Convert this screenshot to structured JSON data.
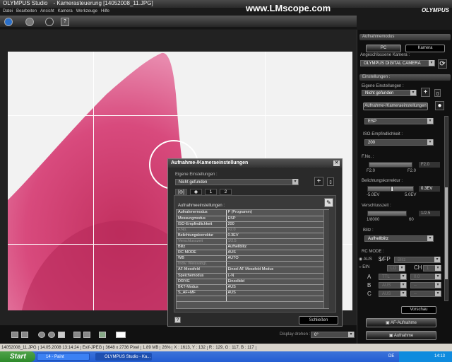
{
  "window": {
    "app": "OLYMPUS Studio",
    "title": "- Kamerasteuerung [14052008_11.JPG]",
    "watermark": "www.LMscope.com",
    "brand": "OLYMPUS"
  },
  "menu": [
    "Datei",
    "Bearbeiten",
    "Ansicht",
    "Kamera",
    "Werkzeuge",
    "Hilfe"
  ],
  "right_panel": {
    "section_mode": "Aufnahmemodus",
    "pc": "PC",
    "camera": "Kamera",
    "connected_camera_label": "Angeschlossene Kamera :",
    "connected_camera": "OLYMPUS DIGITAL CAMERA",
    "section_settings": "Einstellungen :",
    "own_settings_label": "Eigene Einstellungen :",
    "own_settings": "Nicht gefunden",
    "shoot_settings_button": "Aufnahme-/Kameraeinstellungen",
    "metering": "ESP",
    "iso_label": "ISO-Empfindlichkeit :",
    "iso": "200",
    "fno_label": "F.No. :",
    "fno_value": "F2.0",
    "fno_min": "F2.0",
    "fno_max": "F2.0",
    "exp_label": "Belichtungskorrektur :",
    "exp_value": "0.3EV",
    "exp_min": "-5.0EV",
    "exp_max": "5.0EV",
    "exp_fraction": 0.53,
    "shutter_label": "Verschlusszeit :",
    "shutter_value": "1/2.5",
    "shutter_min": "1/8000",
    "shutter_max": "60",
    "flash_label": "Blitz :",
    "flash": "Aufhellblitz",
    "rc_label": "RC MODE :",
    "rc_off": "AUS",
    "rc_on": "EIN",
    "rc_selected": "AUS",
    "fp": "$/FP",
    "fp_value": "Blitz",
    "lo": "LO",
    "ch": "CH",
    "ch_value": "1",
    "groups": [
      {
        "g": "A",
        "mode": "TTL",
        "val": "0.0"
      },
      {
        "g": "B",
        "mode": "AUS",
        "val": "--"
      },
      {
        "g": "C",
        "mode": "AUS",
        "val": "--"
      }
    ],
    "preview": "Vorschau",
    "af_shoot": "AF-Aufnahme",
    "shoot": "Aufnahme"
  },
  "dialog": {
    "title": "Aufnahme-/Kameraeinstellungen",
    "own_label": "Eigene Einstellungen :",
    "own_value": "Nicht gefunden",
    "tabs": [
      "[◎]",
      "◉",
      "1",
      "2"
    ],
    "table_label": "Aufnahmeeinstellungen :",
    "rows": [
      {
        "k": "Aufnahmemodus",
        "v": "P (Programm)"
      },
      {
        "k": "Messungmodus",
        "v": "ESP"
      },
      {
        "k": "ISO-Empfindlichkeit",
        "v": "200"
      },
      {
        "k": "F.No.",
        "v": "F2.0",
        "disabled": true
      },
      {
        "k": "Belichtungskorrektur",
        "v": "0.3EV"
      },
      {
        "k": "Verschlusszeit",
        "v": "1/2.5",
        "disabled": true
      },
      {
        "k": "Blitz",
        "v": "Aufhellblitz"
      },
      {
        "k": "RC MODE",
        "v": "AUS"
      },
      {
        "k": "WB",
        "v": "AUTO"
      },
      {
        "k": "Indiv. Weissabgl.",
        "v": "--",
        "disabled": true
      },
      {
        "k": "AF-Messfeld",
        "v": "Einzel AF Messfeld Modus"
      },
      {
        "k": "Speichemodus",
        "v": "L-N"
      },
      {
        "k": "DRIVE",
        "v": "Einzelbild"
      },
      {
        "k": "BKT-Modus",
        "v": "AUS"
      },
      {
        "k": "S_AF+MF",
        "v": "AUS"
      },
      {
        "k": "",
        "v": ""
      }
    ],
    "close": "Schließen",
    "help": "?"
  },
  "bottom": {
    "rotate_label": "Display drehen :",
    "rotate_value": "0°"
  },
  "status": [
    "14052008_11.JPG",
    "14.05.2008 13:14:24",
    "Exif-JPEG",
    "3648 x 2736 Pixel",
    "1.89 MB",
    "26%",
    "X : 1613, Y : 132",
    "R : 129, G : 117, B : 117"
  ],
  "taskbar": {
    "start": "Start",
    "tasks": [
      "14 - Paint",
      "OLYMPUS Studio - Ka..."
    ],
    "lang": "DE",
    "clock": "14:13"
  },
  "colors": {
    "tissue": "#d9457a",
    "panel": "#101010",
    "taskbar": "#245dd2"
  }
}
